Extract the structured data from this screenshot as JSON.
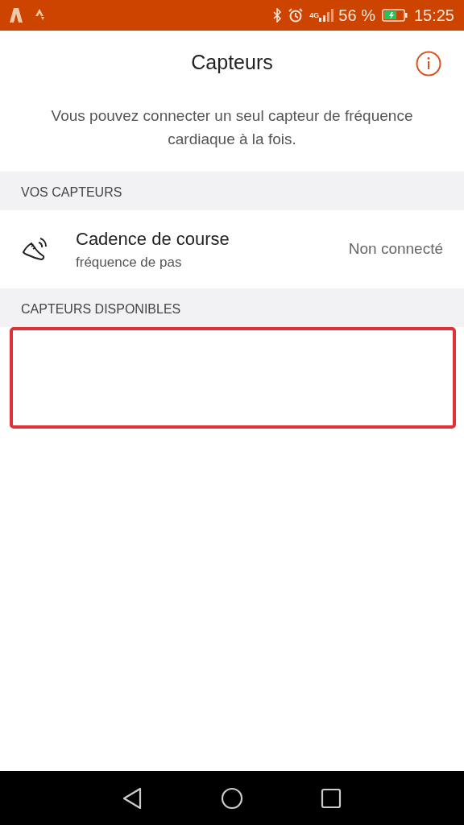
{
  "status_bar": {
    "network": "4G",
    "battery": "56 %",
    "time": "15:25"
  },
  "header": {
    "title": "Capteurs"
  },
  "description": "Vous pouvez connecter un seul capteur de fréquence cardiaque à la fois.",
  "sections": [
    {
      "title": "VOS CAPTEURS",
      "items": [
        {
          "name": "Cadence de course",
          "subtitle": "fréquence de pas",
          "status": "Non connecté"
        }
      ]
    },
    {
      "title": "CAPTEURS DISPONIBLES"
    }
  ],
  "highlight": {
    "kind": "empty-area"
  }
}
